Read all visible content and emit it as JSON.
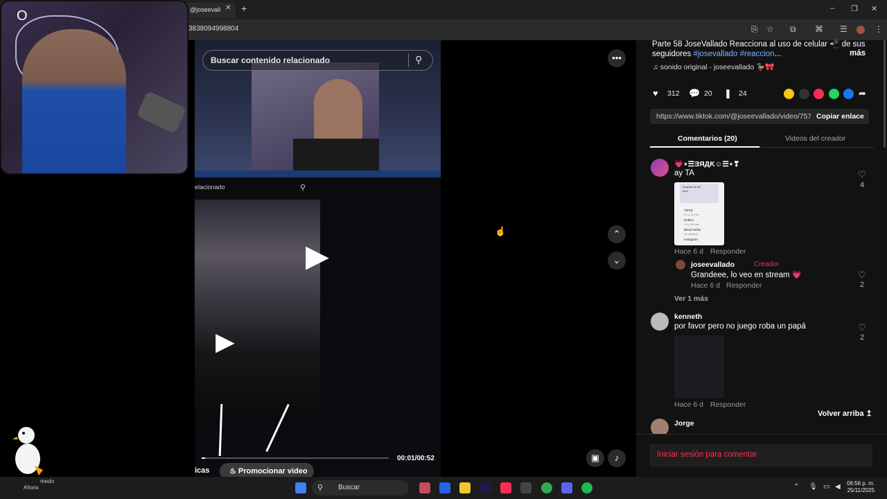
{
  "browser": {
    "tab_title": "@joseevall",
    "url": "3838094998804",
    "new_tab": "+",
    "close_tab": "✕",
    "window_controls": [
      "–",
      "❐",
      "✕"
    ]
  },
  "video": {
    "search_placeholder": "Buscar contenido relacionado",
    "related_label": "elacionado",
    "time": "00:01/00:52",
    "progress": 0.02,
    "promote_button": "Promocionar video",
    "left_label": "icas"
  },
  "post": {
    "description_lead": "Parte 58 JoseVallado Reacciona al uso de celular ",
    "description_emoji": "📲",
    "description_mid": " de sus seguidores ",
    "hashtag_1": "#josevallado",
    "hashtag_2": "#reaccion",
    "description_end": "...",
    "more": "más",
    "sound": "sonido original - joseevallado 🦆🎀",
    "likes": "312",
    "comments": "20",
    "saves": "24",
    "link": "https://www.tiktok.com/@joseevallado/video/757...",
    "copy_link": "Copiar enlace",
    "share_colors": [
      "#f5c518",
      "#333333",
      "#fe2c55",
      "#25d366",
      "#1877f2"
    ]
  },
  "tabs": {
    "comments": "Comentarios (20)",
    "creator_videos": "Videos del creador"
  },
  "comments": [
    {
      "name": "💗⋆☰ƎЯДƘ☺☰⋆❣",
      "text": "ay TA",
      "meta": "Hace 6 d",
      "reply": "Responder",
      "likes": "4",
      "thumb_lines": [
        "mayoría de las",
        "pero",
        "TikTok",
        "3 h y 24 min",
        "Roblox",
        "1 h y 25 min",
        "Blood Strike",
        "42 minutos",
        "Instagram"
      ]
    },
    {
      "name": "joseevallado",
      "creator_label": "Creador",
      "text": "Grandeee, lo veo en stream 💗",
      "meta": "Hace 6 d",
      "reply": "Responder",
      "likes": "2"
    },
    {
      "name": "kenneth",
      "text": "por favor pero no juego roba un papá",
      "meta": "Hace 6 d",
      "reply": "Responder",
      "likes": "2"
    },
    {
      "name": "Jorge"
    }
  ],
  "see_more": "Ver 1 más",
  "back_to_top": "Volver arriba",
  "login_to_comment": "Iniciar sesión para comentar",
  "taskbar": {
    "search": "Buscar",
    "weather_top": "medo",
    "weather_bottom": "Ahora",
    "time": "06:56 p. m.",
    "date": "25/11/2025"
  }
}
